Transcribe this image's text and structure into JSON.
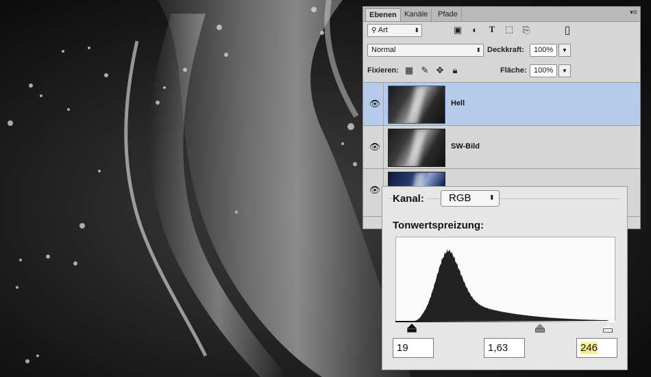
{
  "layers_panel": {
    "tabs": [
      "Ebenen",
      "Kanäle",
      "Pfade"
    ],
    "filter_label": "Art",
    "blend_mode": "Normal",
    "opacity_label": "Deckkraft:",
    "opacity_value": "100%",
    "lock_label": "Fixieren:",
    "fill_label": "Fläche:",
    "fill_value": "100%",
    "layers": [
      {
        "name": "Hell",
        "selected": true
      },
      {
        "name": "SW-Bild",
        "selected": false
      },
      {
        "name": "",
        "selected": false
      }
    ]
  },
  "levels_panel": {
    "channel_label": "Kanal:",
    "channel_value": "RGB",
    "levels_label": "Tonwertspreizung:",
    "black_point": "19",
    "gamma": "1,63",
    "white_point": "246"
  },
  "icons": {
    "search": "search-icon",
    "image": "image-filter-icon",
    "adjust": "adjustment-filter-icon",
    "text": "text-filter-icon",
    "shape": "shape-filter-icon",
    "smart": "smart-object-filter-icon",
    "toggle": "filter-toggle-icon",
    "eye": "eye-icon",
    "lock_pixels": "lock-transparent-icon",
    "lock_brush": "lock-pixels-icon",
    "lock_move": "lock-position-icon",
    "lock_all": "lock-all-icon"
  },
  "colors": {
    "selected_layer": "#b6cbe9",
    "highlight_input": "#f9f08c"
  },
  "histogram": {
    "input_min": 0,
    "input_max": 255,
    "black_point": 19,
    "white_point": 246,
    "gamma": 1.63,
    "peak_position": 0.24
  }
}
